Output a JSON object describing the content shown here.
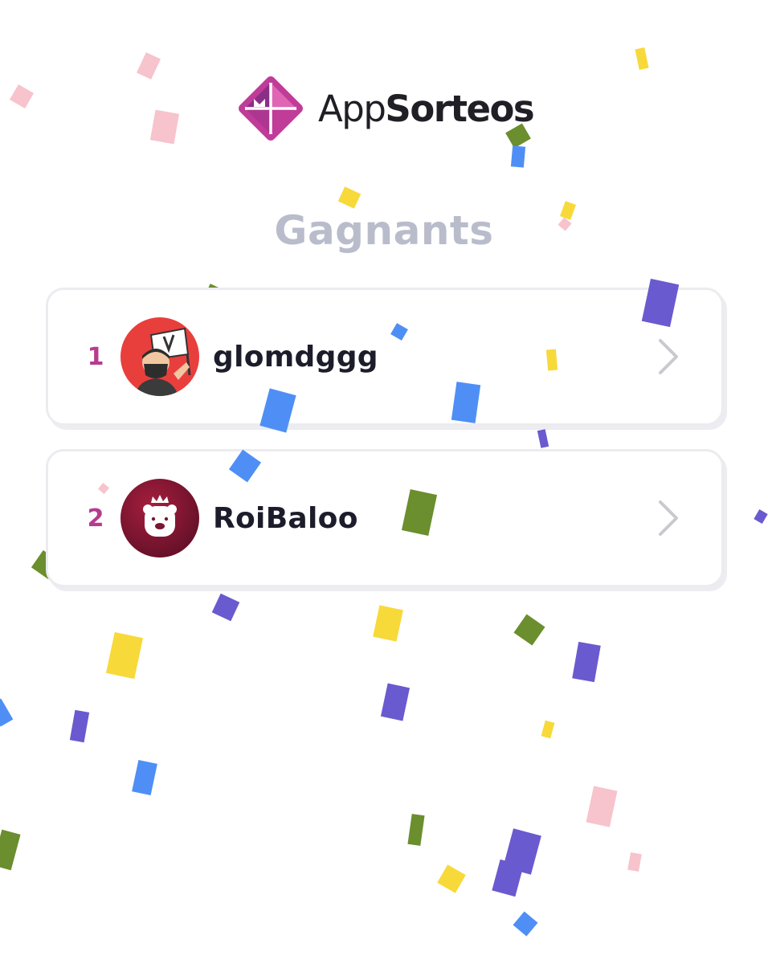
{
  "brand": {
    "name_light": "App",
    "name_bold": "Sorteos",
    "logo_icon": "appsorteos-logo-icon",
    "colors": {
      "primary": "#c03c98",
      "dark": "#8a2f86",
      "light": "#e065b4"
    }
  },
  "page": {
    "title": "Gagnants"
  },
  "winners": [
    {
      "rank": "1",
      "username": "glomdggg",
      "avatar_icon": "ninja-flag-avatar",
      "avatar_bg": "#e83f3d"
    },
    {
      "rank": "2",
      "username": "RoiBaloo",
      "avatar_icon": "crowned-bear-avatar",
      "avatar_bg": "#7c1632"
    }
  ],
  "row_action_icon": "chevron-right-icon",
  "confetti_colors": [
    "#f7c3cd",
    "#4f8ff5",
    "#6a5acf",
    "#6b8e2e",
    "#f7d93a"
  ]
}
